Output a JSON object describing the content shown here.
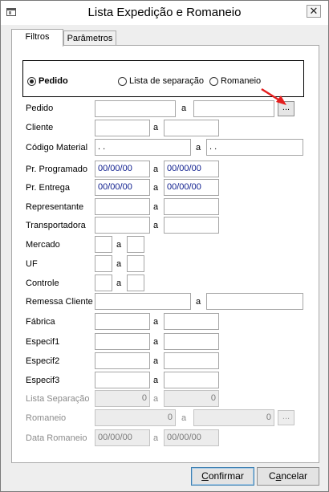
{
  "window": {
    "title": "Lista Expedição e Romaneio",
    "close_label": "✕"
  },
  "tabs": [
    {
      "label": "Filtros",
      "active": true
    },
    {
      "label": "Parâmetros",
      "active": false
    }
  ],
  "options": {
    "selected": "pedido",
    "items": [
      {
        "id": "pedido",
        "label": "Pedido"
      },
      {
        "id": "lista",
        "label": "Lista de separação"
      },
      {
        "id": "romaneio",
        "label": "Romaneio"
      }
    ]
  },
  "range_separator": "a",
  "fields": {
    "pedido": {
      "label": "Pedido",
      "from": "",
      "to": "",
      "lookup": "..."
    },
    "cliente": {
      "label": "Cliente",
      "from": "",
      "to": ""
    },
    "codigo_material": {
      "label": "Código Material",
      "from": " .  .",
      "to": " .  ."
    },
    "pr_programado": {
      "label": "Pr. Programado",
      "from": "00/00/00",
      "to": "00/00/00"
    },
    "pr_entrega": {
      "label": "Pr. Entrega",
      "from": "00/00/00",
      "to": "00/00/00"
    },
    "representante": {
      "label": "Representante",
      "from": "",
      "to": ""
    },
    "transportadora": {
      "label": "Transportadora",
      "from": "",
      "to": ""
    },
    "mercado": {
      "label": "Mercado",
      "from": "",
      "to": ""
    },
    "uf": {
      "label": "UF",
      "from": "",
      "to": ""
    },
    "controle": {
      "label": "Controle",
      "from": "",
      "to": ""
    },
    "remessa_cliente": {
      "label": "Remessa Cliente",
      "from": "",
      "to": ""
    },
    "fabrica": {
      "label": "Fábrica",
      "from": "",
      "to": ""
    },
    "especif1": {
      "label": "Especif1",
      "from": "",
      "to": ""
    },
    "especif2": {
      "label": "Especif2",
      "from": "",
      "to": ""
    },
    "especif3": {
      "label": "Especif3",
      "from": "",
      "to": ""
    },
    "lista_separacao": {
      "label": "Lista Separação",
      "from": "0",
      "to": "0"
    },
    "romaneio": {
      "label": "Romaneio",
      "from": "0",
      "to": "0",
      "lookup": "..."
    },
    "data_romaneio": {
      "label": "Data Romaneio",
      "from": "00/00/00",
      "to": "00/00/00"
    }
  },
  "buttons": {
    "confirm": {
      "hotkey": "C",
      "rest": "onfirmar"
    },
    "cancel": {
      "hotkey": "a",
      "prefix": "C",
      "rest": "ncelar"
    }
  },
  "colors": {
    "date_text": "#0a1a8c",
    "annotation_arrow": "#e41e1e",
    "default_button_border": "#3c7fb1"
  }
}
